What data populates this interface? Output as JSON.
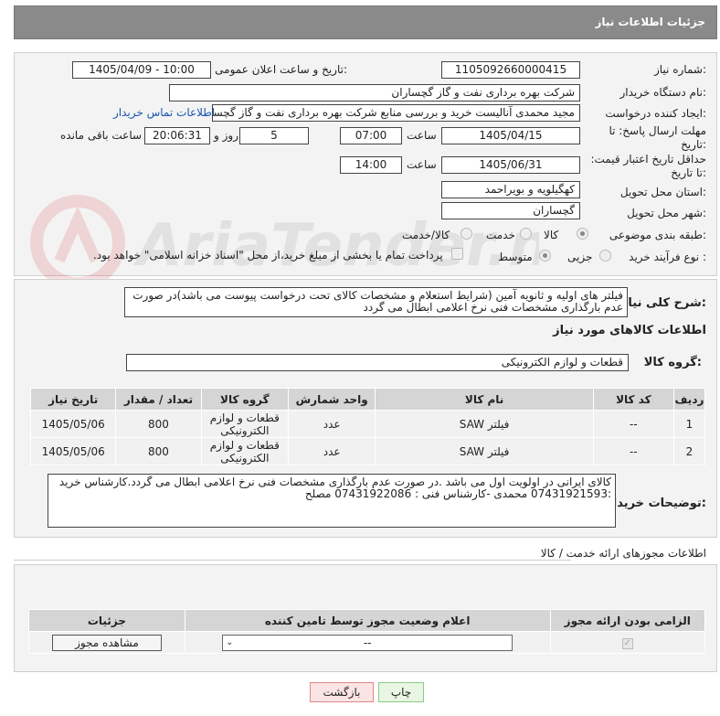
{
  "header": {
    "title": "جزئیات اطلاعات نیاز"
  },
  "form": {
    "need_number_label": "شماره نیاز:",
    "need_number": "1105092660000415",
    "announce_label": "تاریخ و ساعت اعلان عمومی:",
    "announce_value": "1405/04/09 - 10:00",
    "buyer_org_label": "نام دستگاه خریدار:",
    "buyer_org": "شرکت بهره برداری نفت و گاز گچساران",
    "creator_label": "ایجاد کننده درخواست:",
    "creator": "مجید محمدی آنالیست خرید و بررسی منابع شرکت بهره برداری نفت و گاز گچساران",
    "contact_link": "اطلاعات تماس خریدار",
    "deadline_label": "مهلت ارسال پاسخ: تا تاریخ:",
    "deadline_date": "1405/04/15",
    "time_label": "ساعت",
    "deadline_time": "07:00",
    "days_value": "5",
    "days_label": "روز و",
    "remaining_time": "20:06:31",
    "remaining_label": "ساعت باقی مانده",
    "min_price_label": "حداقل تاریخ اعتبار قیمت: تا تاریخ:",
    "min_price_date": "1405/06/31",
    "min_price_time": "14:00",
    "province_label": "استان محل تحویل:",
    "province": "کهگیلویه و بویراحمد",
    "city_label": "شهر محل تحویل:",
    "city": "گچساران",
    "category_label": "طبقه بندی موضوعی:",
    "category_options": [
      "کالا",
      "خدمت",
      "کالا/خدمت"
    ],
    "purchase_type_label": "نوع فرآیند خرید :",
    "purchase_options": [
      "جزیی",
      "متوسط"
    ],
    "payment_note": "پرداخت تمام یا بخشی از مبلغ خرید،از محل \"اسناد خزانه اسلامی\" خواهد بود."
  },
  "summary": {
    "label": "شرح کلی نیاز:",
    "text": "فیلتر های اولیه و ثانویه آمین (شرایط استعلام و مشخصات کالای تحت درخواست پیوست می باشد)در صورت عدم بارگذاری مشخصات فنی نرخ اعلامی ابطال می گردد"
  },
  "goods": {
    "section_title": "اطلاعات کالاهای مورد نیاز",
    "group_label": "گروه کالا:",
    "group_value": "قطعات و لوازم الکترونیکی",
    "columns": [
      "ردیف",
      "کد کالا",
      "نام کالا",
      "واحد شمارش",
      "گروه کالا",
      "تعداد / مقدار",
      "تاریخ نیاز"
    ],
    "rows": [
      {
        "idx": "1",
        "code": "--",
        "name": "فیلتر SAW",
        "unit": "عدد",
        "group": "قطعات و لوازم الکترونیکی",
        "qty": "800",
        "date": "1405/05/06"
      },
      {
        "idx": "2",
        "code": "--",
        "name": "فیلتر SAW",
        "unit": "عدد",
        "group": "قطعات و لوازم الکترونیکی",
        "qty": "800",
        "date": "1405/05/06"
      }
    ]
  },
  "buyer_notes": {
    "label": "توضیحات خریدار:",
    "text": "کالای ایرانی در اولویت اول می باشد .در صورت عدم بارگذاری مشخصات فنی نرخ اعلامی ابطال می گردد.کارشناس خرید :07431921593 محمدی -کارشناس فنی : 07431922086 مصلح"
  },
  "permits": {
    "section_title": "اطلاعات مجوزهای ارائه خدمت / کالا",
    "columns": [
      "الزامی بودن ارائه مجوز",
      "اعلام وضعیت مجوز توسط تامین کننده",
      "جزئیات"
    ],
    "select_value": "--",
    "view_button": "مشاهده مجوز"
  },
  "actions": {
    "print": "چاپ",
    "back": "بازگشت"
  },
  "watermark": "AriaTender.net"
}
